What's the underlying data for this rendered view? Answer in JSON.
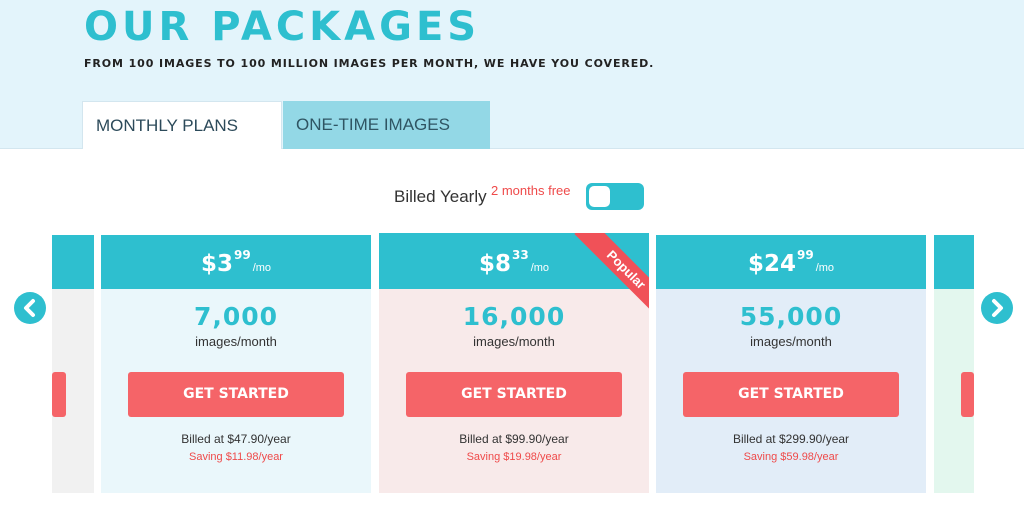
{
  "header": {
    "title": "OUR PACKAGES",
    "subtitle": "FROM 100 IMAGES TO 100 MILLION IMAGES PER MONTH, WE HAVE YOU COVERED."
  },
  "tabs": [
    {
      "label": "MONTHLY PLANS",
      "active": true
    },
    {
      "label": "ONE-TIME IMAGES",
      "active": false
    }
  ],
  "billing": {
    "label": "Billed Yearly",
    "promo": "2 months free",
    "toggle_on": true
  },
  "plans": [
    {
      "price_main": "$3",
      "price_cents": "99",
      "per": "/mo",
      "count": "7,000",
      "unit": "images/month",
      "cta": "GET STARTED",
      "billed": "Billed at $47.90/year",
      "saving": "Saving $11.98/year",
      "bg": "#eaf7fb"
    },
    {
      "price_main": "$8",
      "price_cents": "33",
      "per": "/mo",
      "count": "16,000",
      "unit": "images/month",
      "cta": "GET STARTED",
      "billed": "Billed at $99.90/year",
      "saving": "Saving $19.98/year",
      "badge": "Popular",
      "bg": "#f8eaea"
    },
    {
      "price_main": "$24",
      "price_cents": "99",
      "per": "/mo",
      "count": "55,000",
      "unit": "images/month",
      "cta": "GET STARTED",
      "billed": "Billed at $299.90/year",
      "saving": "Saving $59.98/year",
      "bg": "#e2edf8"
    }
  ],
  "colors": {
    "accent": "#2ebfcf",
    "cta": "#f56468",
    "ribbon": "#f05158",
    "promo": "#ef4a4a"
  },
  "icons": {
    "prev": "chevron-left-icon",
    "next": "chevron-right-icon"
  }
}
